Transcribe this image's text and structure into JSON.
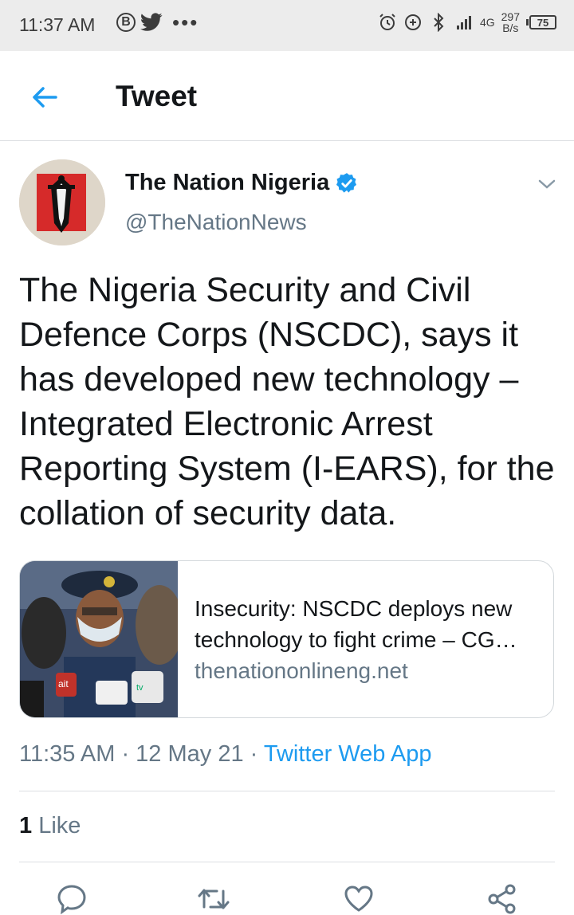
{
  "status_bar": {
    "time": "11:37 AM",
    "network_speed_value": "297",
    "network_speed_unit": "B/s",
    "network_type": "4G",
    "battery": "75"
  },
  "header": {
    "title": "Tweet"
  },
  "tweet": {
    "author_name": "The Nation Nigeria",
    "handle": "@TheNationNews",
    "text": "The Nigeria Security and Civil Defence Corps (NSCDC), says it has developed new technology – Integrated Electronic Arrest Reporting System (I-EARS), for the collation of security data.",
    "card": {
      "title": "Insecurity: NSCDC deploys new technology to fight crime – CG…",
      "domain": "thenationonlineng.net"
    },
    "time": "11:35 AM",
    "date": "12 May 21",
    "source": "Twitter Web App",
    "like_count": "1",
    "like_label": "Like"
  },
  "colors": {
    "accent": "#1d9bf0",
    "secondary_text": "#657786",
    "status_bar_bg": "#ececec"
  },
  "icons": {
    "back": "arrow-left-icon",
    "verified": "verified-badge-icon",
    "caret": "chevron-down-icon",
    "reply": "reply-icon",
    "retweet": "retweet-icon",
    "like": "heart-icon",
    "share": "share-icon"
  }
}
